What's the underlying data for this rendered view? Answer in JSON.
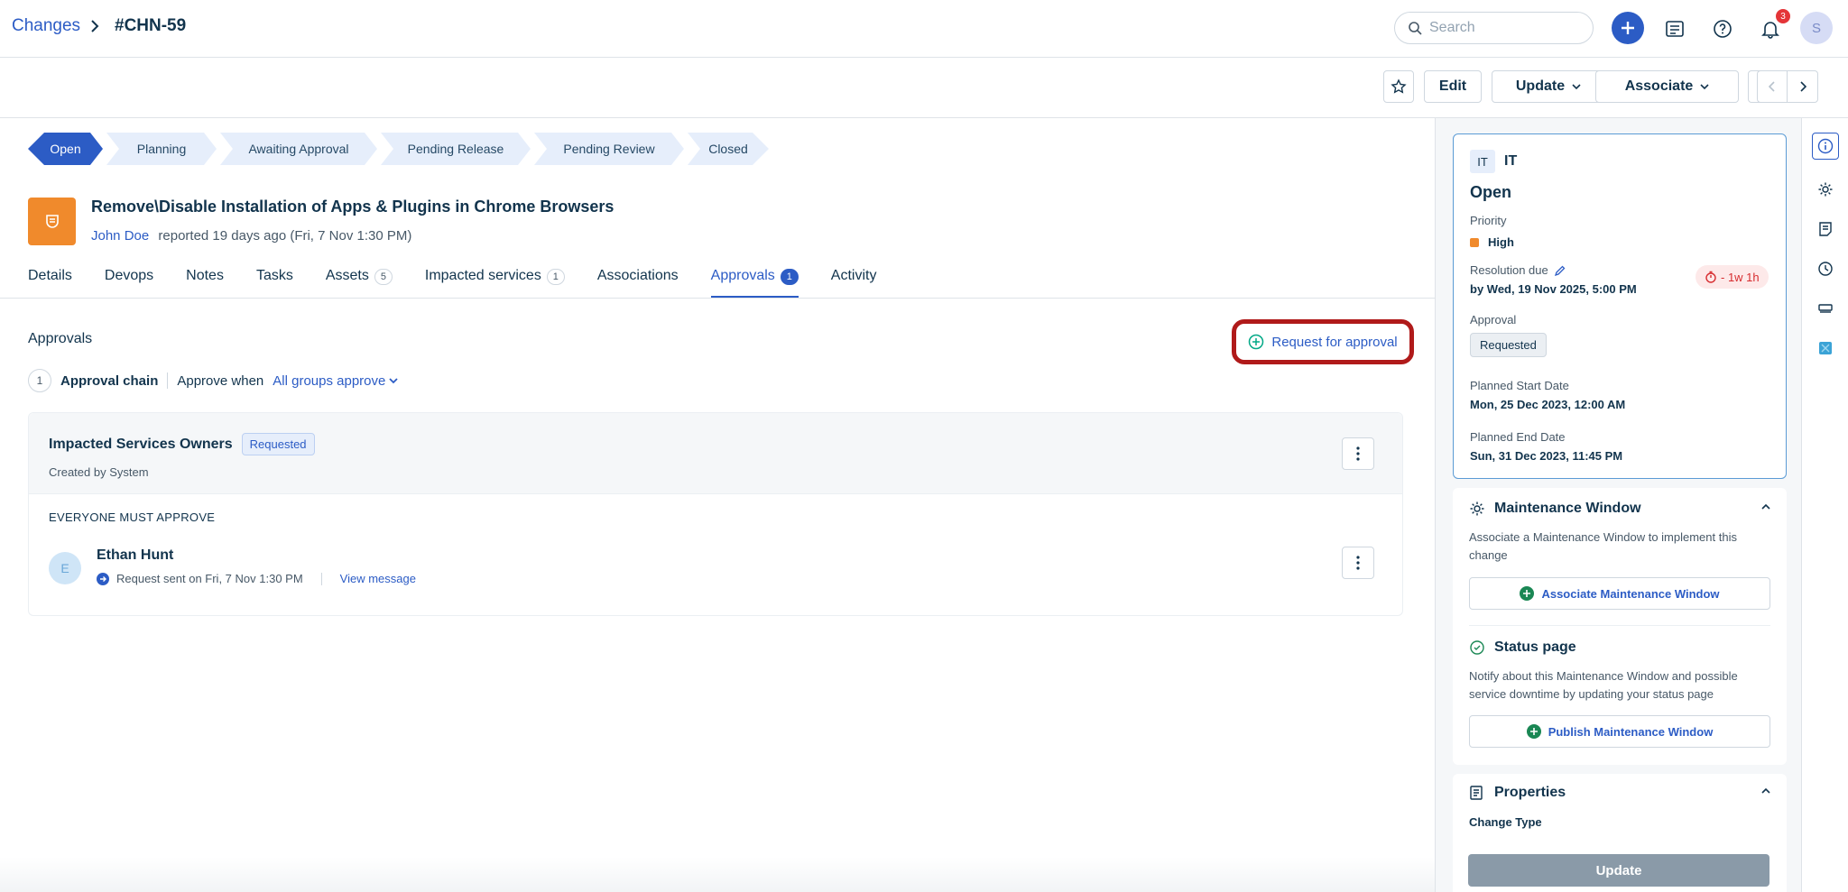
{
  "breadcrumb": {
    "parent": "Changes",
    "current": "#CHN-59"
  },
  "header": {
    "search_placeholder": "Search",
    "notification_count": "3",
    "avatar_initial": "S"
  },
  "toolbar": {
    "edit": "Edit",
    "update": "Update",
    "associate": "Associate"
  },
  "stages": [
    {
      "label": "Open",
      "active": true
    },
    {
      "label": "Planning"
    },
    {
      "label": "Awaiting Approval"
    },
    {
      "label": "Pending Release"
    },
    {
      "label": "Pending Review"
    },
    {
      "label": "Closed"
    }
  ],
  "ticket": {
    "title": "Remove\\Disable Installation of Apps & Plugins in Chrome Browsers",
    "reporter": "John Doe",
    "reported_text": "reported 19 days ago (Fri, 7 Nov 1:30 PM)"
  },
  "tabs": [
    {
      "label": "Details"
    },
    {
      "label": "Devops"
    },
    {
      "label": "Notes"
    },
    {
      "label": "Tasks"
    },
    {
      "label": "Assets",
      "count": "5"
    },
    {
      "label": "Impacted services",
      "count": "1"
    },
    {
      "label": "Associations"
    },
    {
      "label": "Approvals",
      "count": "1",
      "active": true
    },
    {
      "label": "Activity"
    }
  ],
  "approvals": {
    "section_label": "Approvals",
    "request_button": "Request for approval",
    "chain_number": "1",
    "chain_label": "Approval chain",
    "approve_when_label": "Approve when",
    "approve_when_value": "All groups approve",
    "group": {
      "name": "Impacted Services Owners",
      "status": "Requested",
      "created_by": "Created by System",
      "rule": "EVERYONE MUST APPROVE",
      "approver": {
        "initial": "E",
        "name": "Ethan Hunt",
        "request_text": "Request sent on Fri, 7 Nov 1:30 PM",
        "view_message": "View message"
      }
    }
  },
  "side": {
    "workspace_chip": "IT",
    "workspace_name": "IT",
    "status": "Open",
    "priority_label": "Priority",
    "priority_value": "High",
    "priority_color": "#f08a2c",
    "resolution_label": "Resolution due",
    "resolution_value": "by Wed, 19 Nov 2025, 5:00 PM",
    "overdue": "- 1w 1h",
    "approval_label": "Approval",
    "approval_value": "Requested",
    "planned_start_label": "Planned Start Date",
    "planned_start_value": "Mon, 25 Dec 2023, 12:00 AM",
    "planned_end_label": "Planned End Date",
    "planned_end_value": "Sun, 31 Dec 2023, 11:45 PM",
    "maintenance": {
      "title": "Maintenance Window",
      "desc": "Associate a Maintenance Window to implement this change",
      "button": "Associate Maintenance Window"
    },
    "status_page": {
      "title": "Status page",
      "desc": "Notify about this Maintenance Window and possible service downtime by updating your status page",
      "button": "Publish Maintenance Window"
    },
    "properties": {
      "title": "Properties",
      "change_type_label": "Change Type",
      "update_button": "Update"
    }
  },
  "colors": {
    "accent": "#2c5cc5",
    "highlight_ring": "#b01a1a",
    "ticket_icon": "#f08a2c"
  }
}
